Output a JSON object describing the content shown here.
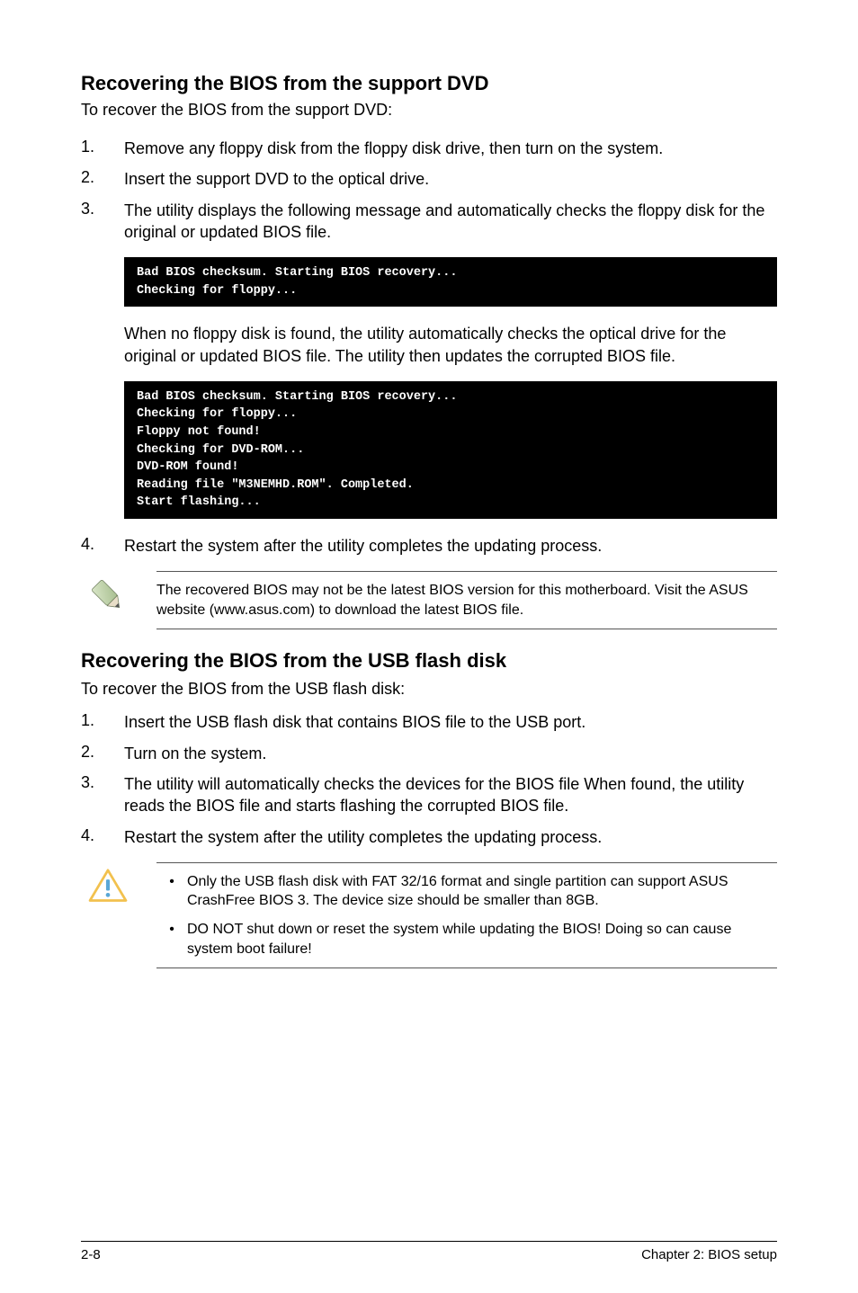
{
  "section1": {
    "title": "Recovering the BIOS from the support DVD",
    "intro": "To recover the BIOS from the support DVD:",
    "steps": {
      "s1": {
        "n": "1.",
        "t": "Remove any floppy disk from the floppy disk drive, then turn on the system."
      },
      "s2": {
        "n": "2.",
        "t": "Insert the support DVD to the optical drive."
      },
      "s3": {
        "n": "3.",
        "t": "The utility displays the following message and automatically checks the floppy disk for the original or updated BIOS file."
      }
    },
    "code1": "Bad BIOS checksum. Starting BIOS recovery...\nChecking for floppy...",
    "para1": "When no floppy disk is found, the utility automatically checks the optical drive for the original or updated BIOS file. The utility then updates the corrupted BIOS file.",
    "code2": "Bad BIOS checksum. Starting BIOS recovery...\nChecking for floppy...\nFloppy not found!\nChecking for DVD-ROM...\nDVD-ROM found!\nReading file \"M3NEMHD.ROM\". Completed.\nStart flashing...",
    "step4": {
      "n": " 4.",
      "t": "Restart the system after the utility completes the updating process."
    },
    "note": "The recovered BIOS may not be the latest BIOS version for this motherboard. Visit the ASUS website (www.asus.com) to download the latest BIOS file."
  },
  "section2": {
    "title": "Recovering the BIOS from the USB flash disk",
    "intro": "To recover the BIOS from the USB flash disk:",
    "steps": {
      "s1": {
        "n": "1.",
        "t": "Insert the USB flash disk that contains BIOS file to the USB port."
      },
      "s2": {
        "n": "2.",
        "t": "Turn on the system."
      },
      "s3": {
        "n": "3.",
        "t": "The utility will automatically checks the devices for the BIOS file When found, the utility reads the BIOS file and starts flashing the corrupted BIOS file."
      },
      "s4": {
        "n": "4.",
        "t": "Restart the system after the utility completes the updating process."
      }
    },
    "warn": {
      "b1": "Only the USB flash disk with FAT 32/16 format and single partition can support ASUS CrashFree BIOS 3. The device size should be smaller than 8GB.",
      "b2": "DO NOT shut down or reset the system while updating the BIOS! Doing so can cause system boot failure!"
    }
  },
  "footer": {
    "left": "2-8",
    "right": "Chapter 2: BIOS setup"
  },
  "bullet": "•"
}
